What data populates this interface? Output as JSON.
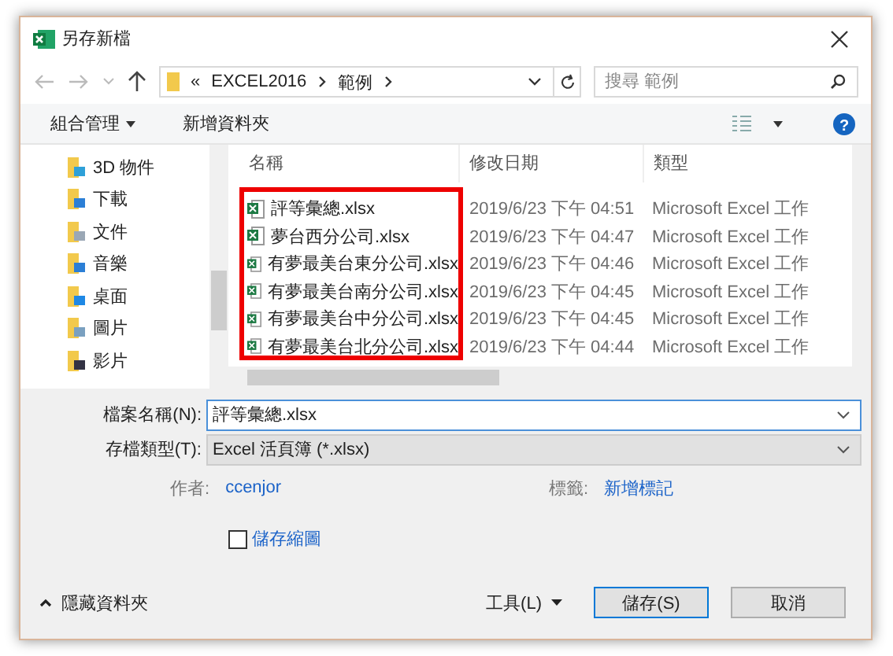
{
  "window": {
    "title": "另存新檔"
  },
  "address_bar": {
    "overflow": "«",
    "path": [
      "EXCEL2016",
      "範例"
    ]
  },
  "search": {
    "placeholder": "搜尋 範例"
  },
  "toolbar": {
    "organize": "組合管理",
    "new_folder": "新增資料夾",
    "help": "?"
  },
  "sidebar": {
    "items": [
      {
        "label": "3D 物件",
        "kind": "objects3d"
      },
      {
        "label": "下載",
        "kind": "downloads"
      },
      {
        "label": "文件",
        "kind": "documents"
      },
      {
        "label": "音樂",
        "kind": "music"
      },
      {
        "label": "桌面",
        "kind": "desktop"
      },
      {
        "label": "圖片",
        "kind": "pictures"
      },
      {
        "label": "影片",
        "kind": "videos"
      }
    ]
  },
  "file_list": {
    "columns": [
      "名稱",
      "修改日期",
      "類型"
    ],
    "rows": [
      {
        "name": "評等彙總.xlsx",
        "date": "2019/6/23 下午 04:51",
        "type": "Microsoft Excel 工作"
      },
      {
        "name": "夢台西分公司.xlsx",
        "date": "2019/6/23 下午 04:47",
        "type": "Microsoft Excel 工作"
      },
      {
        "name": "有夢最美台東分公司.xlsx",
        "date": "2019/6/23 下午 04:46",
        "type": "Microsoft Excel 工作"
      },
      {
        "name": "有夢最美台南分公司.xlsx",
        "date": "2019/6/23 下午 04:45",
        "type": "Microsoft Excel 工作"
      },
      {
        "name": "有夢最美台中分公司.xlsx",
        "date": "2019/6/23 下午 04:45",
        "type": "Microsoft Excel 工作"
      },
      {
        "name": "有夢最美台北分公司.xlsx",
        "date": "2019/6/23 下午 04:44",
        "type": "Microsoft Excel 工作"
      }
    ]
  },
  "form": {
    "file_name_label": "檔案名稱(N):",
    "file_name": "評等彙總.xlsx",
    "type_label": "存檔類型(T):",
    "type_value": "Excel 活頁簿 (*.xlsx)",
    "author_label": "作者:",
    "author": "ccenjor",
    "tags_label": "標籤:",
    "tags": "新增標記"
  },
  "thumbnail": {
    "label": "儲存縮圖",
    "checked": false
  },
  "footer": {
    "hide_folders": "隱藏資料夾",
    "tools": "工具(L)",
    "save": "儲存(S)",
    "cancel": "取消"
  }
}
